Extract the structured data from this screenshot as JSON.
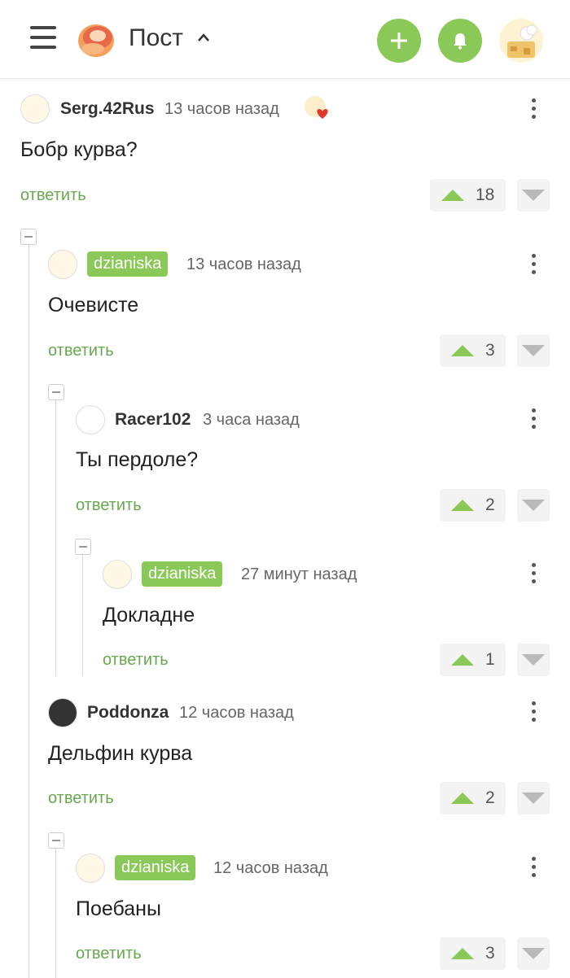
{
  "header": {
    "title": "Пост",
    "icons": {
      "menu": "menu-icon",
      "logo": "pikabu-logo",
      "add": "plus-icon",
      "bell": "bell-icon",
      "avatar": "user-avatar"
    },
    "accent": "#8ac858"
  },
  "comments": [
    {
      "author": "Serg.42Rus",
      "time": "13 часов назад",
      "text": "Бобр курва?",
      "reply": "ответить",
      "rating": "18",
      "badge": false
    },
    {
      "author": "dzianiska",
      "time": "13 часов назад",
      "text": "Очевисте",
      "reply": "ответить",
      "rating": "3",
      "badge": true
    },
    {
      "author": "Racer102",
      "time": "3 часа назад",
      "text": "Ты пердоле?",
      "reply": "ответить",
      "rating": "2",
      "badge": false
    },
    {
      "author": "dzianiska",
      "time": "27 минут назад",
      "text": "Докладне",
      "reply": "ответить",
      "rating": "1",
      "badge": true
    },
    {
      "author": "Poddonza",
      "time": "12 часов назад",
      "text": "Дельфин курва",
      "reply": "ответить",
      "rating": "2",
      "badge": false
    },
    {
      "author": "dzianiska",
      "time": "12 часов назад",
      "text": "Поебаны",
      "reply": "ответить",
      "rating": "3",
      "badge": true
    }
  ]
}
